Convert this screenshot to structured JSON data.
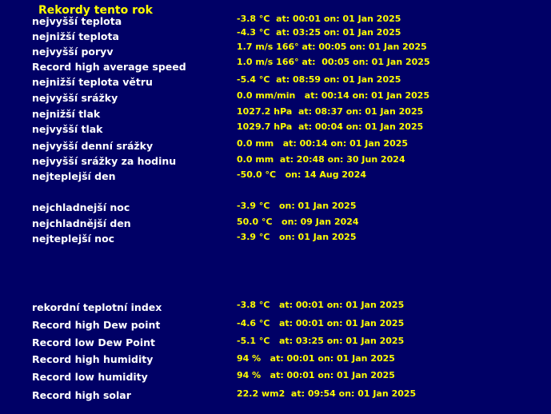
{
  "page": {
    "title": "Rekordy tento rok"
  },
  "records": [
    {
      "label": "nejvyšší teplota",
      "value": "-3.8 °C  at: 00:01 on: 01 Jan 2025"
    },
    {
      "label": "nejnižší teplota",
      "value": "-4.3 °C  at: 03:25 on: 01 Jan 2025"
    },
    {
      "label": "nejvyšší poryv",
      "value": "1.7 m/s 166° at: 00:05 on: 01 Jan 2025"
    },
    {
      "label": "Record high average speed",
      "value": "1.0 m/s 166° at:  00:05 on: 01 Jan 2025"
    },
    {
      "label": "nejnižší teplota větru",
      "value": "-5.4 °C  at: 08:59 on: 01 Jan 2025"
    },
    {
      "label": "nejvyšší srážky",
      "value": "0.0 mm/min   at: 00:14 on: 01 Jan 2025"
    },
    {
      "label": "nejnižší tlak",
      "value": "1027.2 hPa  at: 08:37 on: 01 Jan 2025"
    },
    {
      "label": "nejvyšší tlak",
      "value": "1029.7 hPa  at: 00:04 on: 01 Jan 2025"
    },
    {
      "label": "nejvyšší denní srážky",
      "value": "0.0 mm   at: 00:14 on: 01 Jan 2025"
    },
    {
      "label": "nejvyšší srážky za hodinu",
      "value": "0.0 mm  at: 20:48 on: 30 Jun 2024"
    },
    {
      "label": "nejteplejší den",
      "value": "-50.0 °C   on: 14 Aug 2024"
    },
    {
      "label": "nejchladnejší noc",
      "value": "-3.9 °C   on: 01 Jan 2025"
    },
    {
      "label": "nejchladnější den",
      "value": "50.0 °C   on: 09 Jan 2024"
    },
    {
      "label": "nejteplejší noc",
      "value": "-3.9 °C   on: 01 Jan 2025"
    },
    {
      "label": "rekordní teplotní index",
      "value": "-3.8 °C   at: 00:01 on: 01 Jan 2025"
    },
    {
      "label": "Record high Dew point",
      "value": "-4.6 °C   at: 00:01 on: 01 Jan 2025"
    },
    {
      "label": "Record low Dew Point",
      "value": "-5.1 °C   at: 03:25 on: 01 Jan 2025"
    },
    {
      "label": "Record high humidity",
      "value": "94 %   at: 00:01 on: 01 Jan 2025"
    },
    {
      "label": "Record low humidity",
      "value": "94 %   at: 00:01 on: 01 Jan 2025"
    },
    {
      "label": "Record high solar",
      "value": "22.2 wm2  at: 09:54 on: 01 Jan 2025"
    }
  ],
  "colors": {
    "background": "#000066",
    "label": "#ffffff",
    "value": "#ffff00",
    "title": "#ffff00"
  }
}
